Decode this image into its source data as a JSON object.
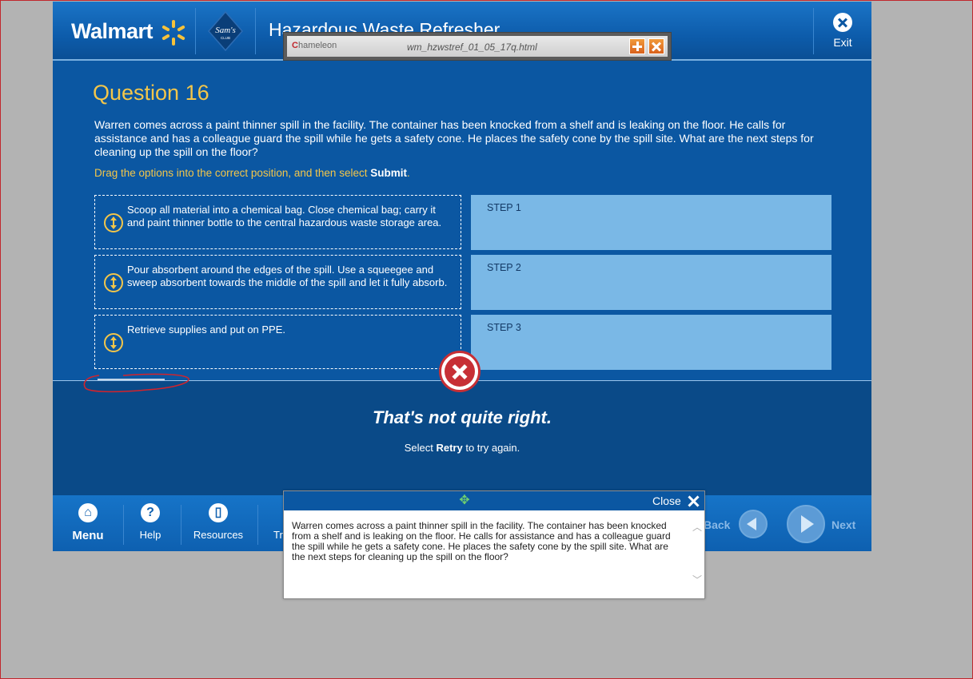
{
  "header": {
    "walmart_logo": "Walmart",
    "sams_logo_line1": "Sam's",
    "sams_logo_line2": "CLUB",
    "course_title": "Hazardous Waste Refresher",
    "exit_label": "Exit"
  },
  "chameleon": {
    "logo_text": "hameleon",
    "filename": "wm_hzwstref_01_05_17q.html"
  },
  "question": {
    "title": "Question 16",
    "text": "Warren comes across a paint thinner spill in the facility.  The container has been knocked from a shelf and is leaking on the floor.  He calls for assistance and has a colleague guard the spill while he gets a safety cone.  He places the safety cone by the spill site.  What are the next steps for cleaning up the spill on the floor?",
    "instruction_prefix": "Drag the options into the correct position, and then select ",
    "instruction_bold": "Submit",
    "instruction_suffix": "."
  },
  "options": [
    {
      "text": "Scoop all material into a chemical bag.  Close chemical bag; carry it and paint thinner bottle to the central hazardous waste storage area."
    },
    {
      "text": "Pour absorbent around the edges of the spill.  Use a squeegee and sweep absorbent towards the middle of the spill and let it fully absorb."
    },
    {
      "text": "Retrieve supplies and put on PPE."
    }
  ],
  "steps": [
    {
      "label": "STEP 1"
    },
    {
      "label": "STEP 2"
    },
    {
      "label": "STEP 3"
    }
  ],
  "feedback": {
    "title": "That's not quite right.",
    "sub_prefix": "Select ",
    "sub_bold": "Retry",
    "sub_suffix": " to try again."
  },
  "footer": {
    "menu_label": "Menu",
    "help_label": "Help",
    "resources_label": "Resources",
    "transcript_label_partial": "Tr",
    "back_label_partial": "Back",
    "next_label": "Next"
  },
  "popup": {
    "close_label": "Close",
    "text": "Warren comes across a paint thinner spill in the facility.  The container has been knocked from a shelf and is leaking on the floor.  He calls for assistance and has a colleague guard the spill while he gets a safety cone.  He places the safety cone by the spill site.  What are the next steps for cleaning up the spill on the floor?"
  },
  "colors": {
    "course_blue": "#0b57a2",
    "accent_gold": "#f3c64a",
    "step_box": "#7ab8e6",
    "error_red": "#c72f35"
  },
  "icons": [
    "spark-icon",
    "exit-icon",
    "drag-handle-icon",
    "error-x-icon",
    "home-icon",
    "help-icon",
    "resources-icon",
    "back-arrow-icon",
    "next-arrow-icon",
    "move-icon",
    "close-icon",
    "plus-icon",
    "scroll-up-icon",
    "scroll-down-icon"
  ]
}
